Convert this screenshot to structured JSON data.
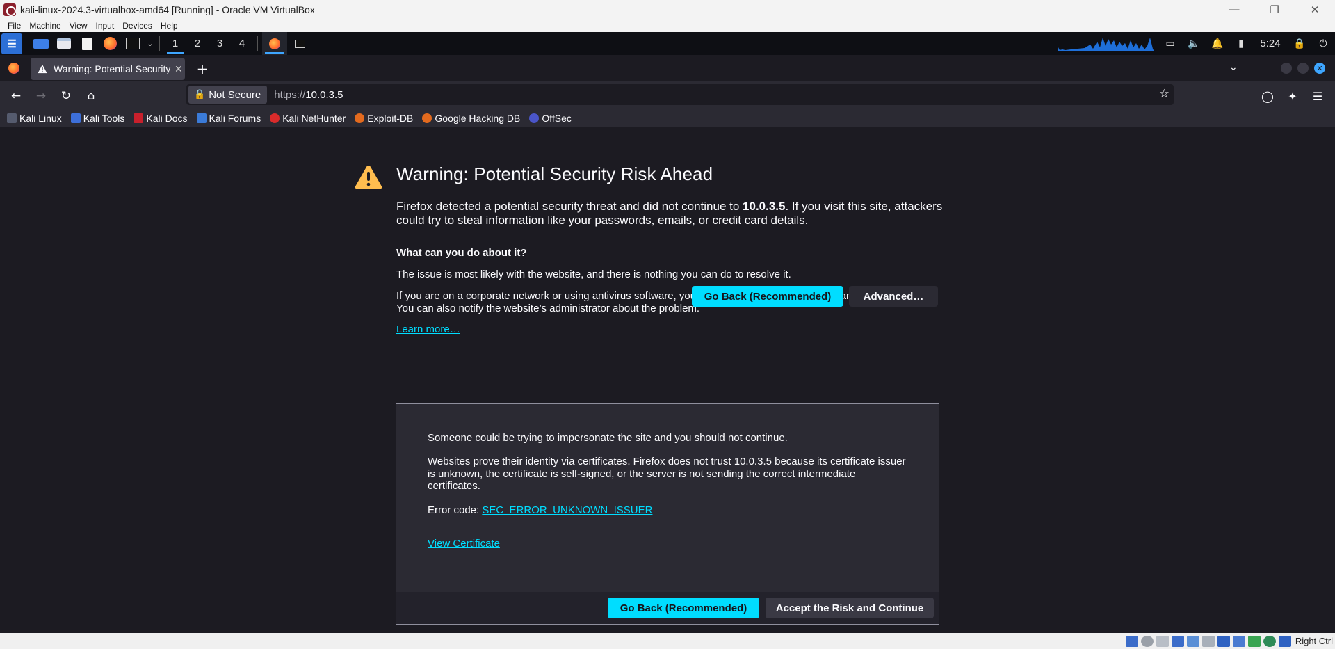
{
  "vbox": {
    "window_title": "kali-linux-2024.3-virtualbox-amd64 [Running] - Oracle VM VirtualBox",
    "menu": [
      "File",
      "Machine",
      "View",
      "Input",
      "Devices",
      "Help"
    ],
    "host_key": "Right Ctrl"
  },
  "kali_panel": {
    "workspaces": [
      "1",
      "2",
      "3",
      "4"
    ],
    "active_workspace": "1",
    "clock": "5:24"
  },
  "firefox": {
    "tab_title": "Warning: Potential Security Risk Ahead",
    "url_security": "Not Secure",
    "url_scheme": "https://",
    "url_host": "10.0.3.5",
    "bookmarks": [
      "Kali Linux",
      "Kali Tools",
      "Kali Docs",
      "Kali Forums",
      "Kali NetHunter",
      "Exploit-DB",
      "Google Hacking DB",
      "OffSec"
    ]
  },
  "page": {
    "title": "Warning: Potential Security Risk Ahead",
    "intro_before": "Firefox detected a potential security threat and did not continue to ",
    "intro_host": "10.0.3.5",
    "intro_after": ". If you visit this site, attackers could try to steal information like your passwords, emails, or credit card details.",
    "what_heading": "What can you do about it?",
    "para1": "The issue is most likely with the website, and there is nothing you can do to resolve it.",
    "para2": "If you are on a corporate network or using antivirus software, you can reach out to the support teams for assistance. You can also notify the website’s administrator about the problem.",
    "learn_more": "Learn more…",
    "go_back": "Go Back (Recommended)",
    "advanced": "Advanced…",
    "adv_text1": "Someone could be trying to impersonate the site and you should not continue.",
    "adv_text2": "Websites prove their identity via certificates. Firefox does not trust 10.0.3.5 because its certificate issuer is unknown, the certificate is self-signed, or the server is not sending the correct intermediate certificates.",
    "error_label": "Error code: ",
    "error_code": "SEC_ERROR_UNKNOWN_ISSUER",
    "view_certificate": "View Certificate",
    "go_back_2": "Go Back (Recommended)",
    "accept_risk": "Accept the Risk and Continue"
  },
  "colors": {
    "accent": "#00ddff",
    "page_bg": "#1c1b22",
    "warning": "#ffbd4f"
  }
}
